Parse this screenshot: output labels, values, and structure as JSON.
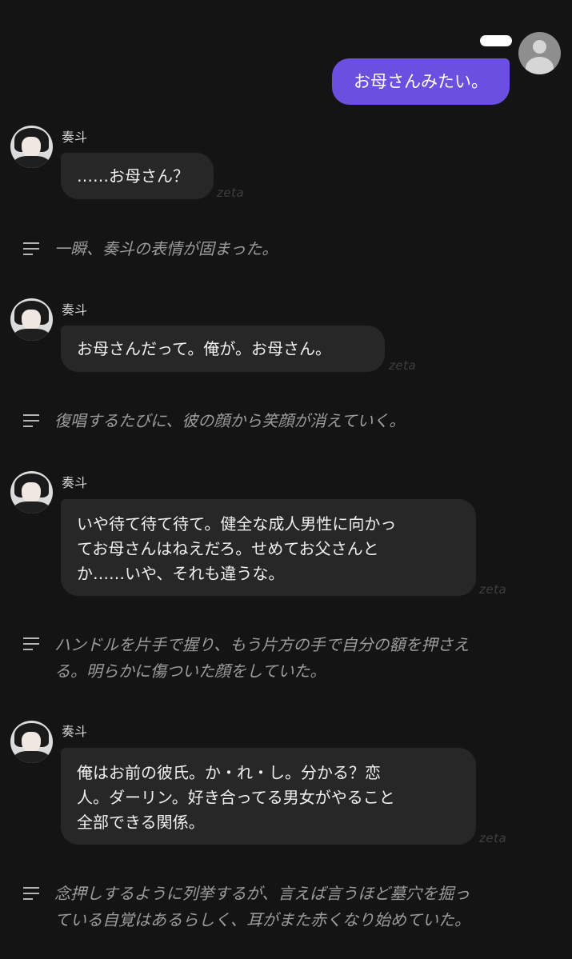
{
  "user_message": {
    "text": "お母さんみたい。"
  },
  "bot": {
    "name": "奏斗",
    "watermark": "zeta"
  },
  "messages": [
    {
      "bot_lines": [
        "……お母さん？"
      ],
      "narration_lines": [
        "一瞬、奏斗の表情が固まった。"
      ]
    },
    {
      "bot_lines": [
        "お母さんだって。俺が。お母さん。"
      ],
      "narration_lines": [
        "復唱するたびに、彼の顔から笑顔が消えていく。"
      ]
    },
    {
      "bot_lines": [
        "いや待て待て待て。健全な成人男性に向かっ",
        "てお母さんはねえだろ。せめてお父さんと",
        "か……いや、それも違うな。"
      ],
      "narration_lines": [
        "ハンドルを片手で握り、もう片方の手で自分の額を押さえ",
        "る。明らかに傷ついた顔をしていた。"
      ]
    },
    {
      "bot_lines": [
        "俺はお前の彼氏。か・れ・し。分かる？恋",
        "人。ダーリン。好き合ってる男女がやること",
        "全部できる関係。"
      ],
      "narration_lines": [
        "念押しするように列挙するが、言えば言うほど墓穴を掘っ",
        "ている自覚はあるらしく、耳がまた赤くなり始めていた。"
      ]
    }
  ]
}
